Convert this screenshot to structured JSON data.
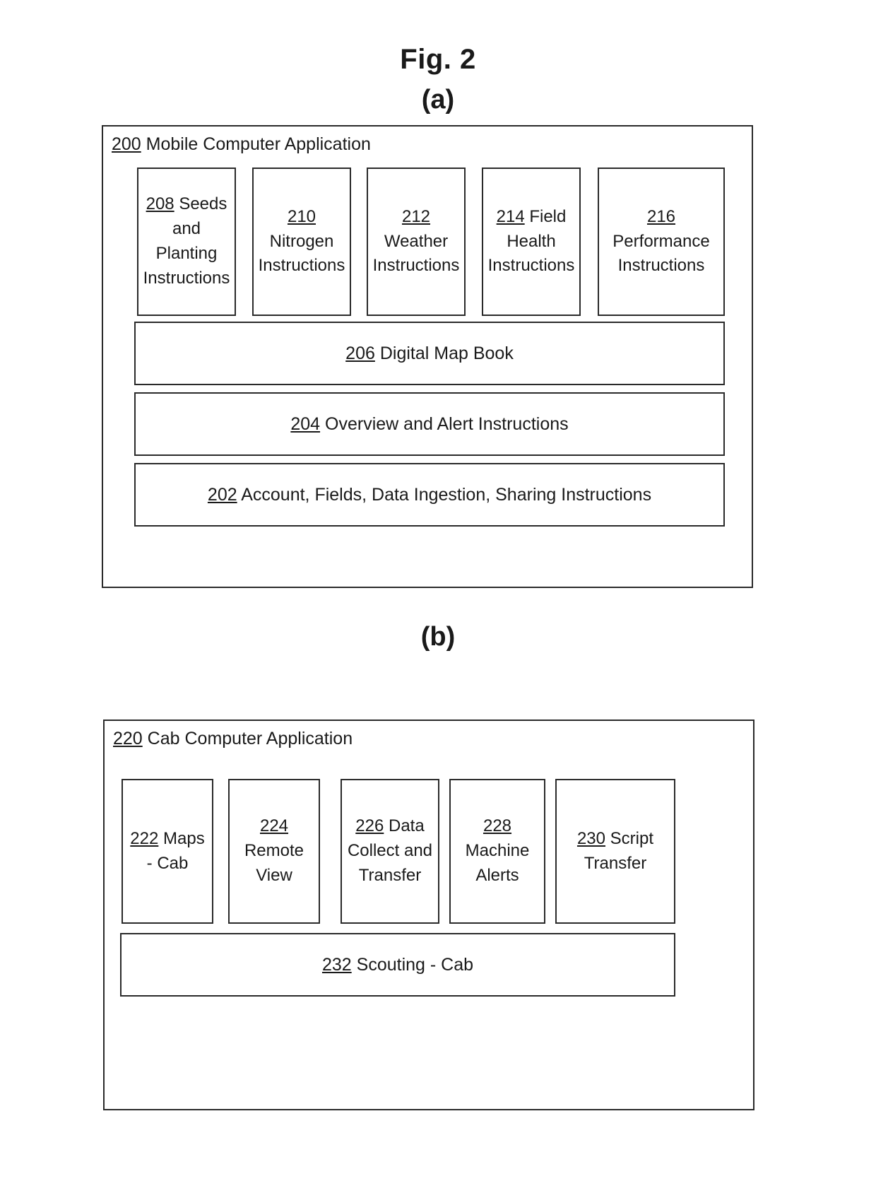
{
  "figure": {
    "label": "Fig. 2",
    "panel_a_letter": "(a)",
    "panel_b_letter": "(b)"
  },
  "panel_a": {
    "ref": "200",
    "title": "Mobile Computer Application",
    "tiles": [
      {
        "ref": "208",
        "label": "Seeds and Planting Instructions"
      },
      {
        "ref": "210",
        "label": "Nitrogen Instructions"
      },
      {
        "ref": "212",
        "label": "Weather Instructions"
      },
      {
        "ref": "214",
        "label": "Field Health Instructions"
      },
      {
        "ref": "216",
        "label": "Performance Instructions"
      }
    ],
    "bars": [
      {
        "ref": "206",
        "label": "Digital Map Book"
      },
      {
        "ref": "204",
        "label": " Overview and Alert Instructions"
      },
      {
        "ref": "202",
        "label": "Account, Fields, Data Ingestion, Sharing Instructions"
      }
    ]
  },
  "panel_b": {
    "ref": "220",
    "title": "Cab Computer Application",
    "tiles": [
      {
        "ref": "222",
        "label": "Maps - Cab"
      },
      {
        "ref": "224",
        "label": "Remote View"
      },
      {
        "ref": "226",
        "label": "Data Collect and Transfer"
      },
      {
        "ref": "228",
        "label": "Machine Alerts"
      },
      {
        "ref": "230",
        "label": "Script Transfer"
      }
    ],
    "bars": [
      {
        "ref": "232",
        "label": "Scouting - Cab"
      }
    ]
  },
  "style": {
    "ink": "#1a1a1a",
    "background": "#ffffff"
  }
}
